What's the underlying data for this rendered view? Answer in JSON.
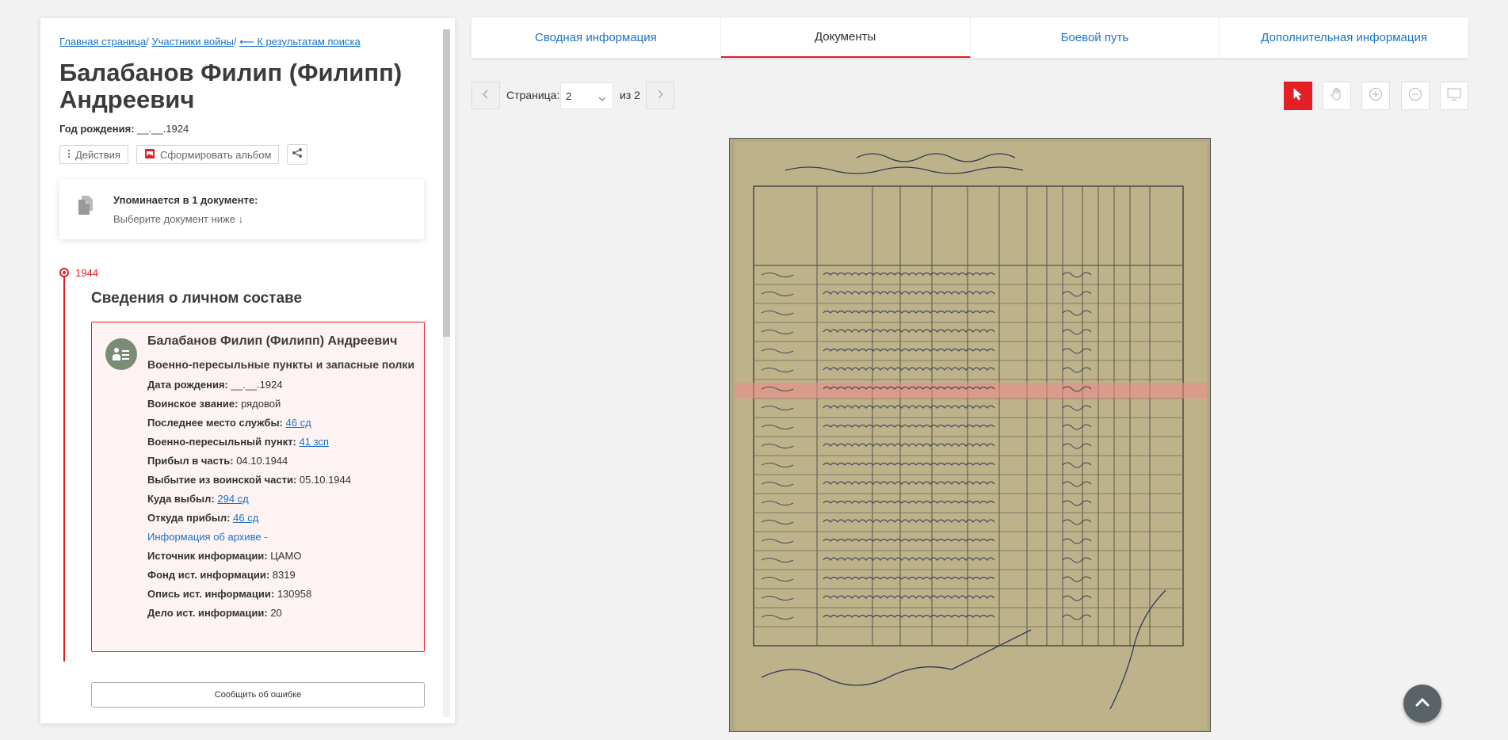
{
  "breadcrumb": {
    "home": "Главная страница",
    "participants": "Участники войны",
    "back": "⟵ К результатам поиска",
    "sep": "/"
  },
  "hero": {
    "name": "Балабанов Филип (Филипп) Андреевич",
    "birth_label": "Год рождения:",
    "birth_value": "__.__.1924"
  },
  "actions": {
    "actions_label": "Действия",
    "album_label": "Сформировать альбом",
    "share_icon": "share-icon"
  },
  "mention": {
    "title": "Упоминается в 1 документе:",
    "subtitle": "Выберите документ ниже ↓"
  },
  "timeline": {
    "year": "1944",
    "section_title": "Сведения о личном составе"
  },
  "record": {
    "name": "Балабанов Филип (Филипп) Андреевич",
    "category": "Военно-пересыльные пункты и запасные полки",
    "rows": [
      {
        "label": "Дата рождения:",
        "value": "__.__.1924",
        "is_link": false
      },
      {
        "label": "Воинское звание:",
        "value": "рядовой",
        "is_link": false
      },
      {
        "label": "Последнее место службы:",
        "value": "46 сд",
        "is_link": true
      },
      {
        "label": "Военно-пересыльный пункт:",
        "value": "41 зсп",
        "is_link": true
      },
      {
        "label": "Прибыл в часть:",
        "value": "04.10.1944",
        "is_link": false
      },
      {
        "label": "Выбытие из воинской части:",
        "value": "05.10.1944",
        "is_link": false
      },
      {
        "label": "Куда выбыл:",
        "value": "294 сд",
        "is_link": true
      },
      {
        "label": "Откуда прибыл:",
        "value": "46 сд",
        "is_link": true
      }
    ],
    "archive_link": "Информация об архиве -",
    "source_rows": [
      {
        "label": "Источник информации:",
        "value": "ЦАМО"
      },
      {
        "label": "Фонд ист. информации:",
        "value": "8319"
      },
      {
        "label": "Опись ист. информации:",
        "value": "130958"
      },
      {
        "label": "Дело ист. информации:",
        "value": "20"
      }
    ]
  },
  "report_button": "Сообщить об ошибке",
  "tabs": [
    {
      "label": "Сводная информация",
      "active": false
    },
    {
      "label": "Документы",
      "active": true
    },
    {
      "label": "Боевой путь",
      "active": false
    },
    {
      "label": "Дополнительная информация",
      "active": false
    }
  ],
  "pager": {
    "page_label": "Страница:",
    "current_page": "2",
    "of_label": "из 2"
  },
  "colors": {
    "accent": "#e31e24",
    "link": "#1a73c8",
    "record_bg": "#fdf3f3"
  }
}
